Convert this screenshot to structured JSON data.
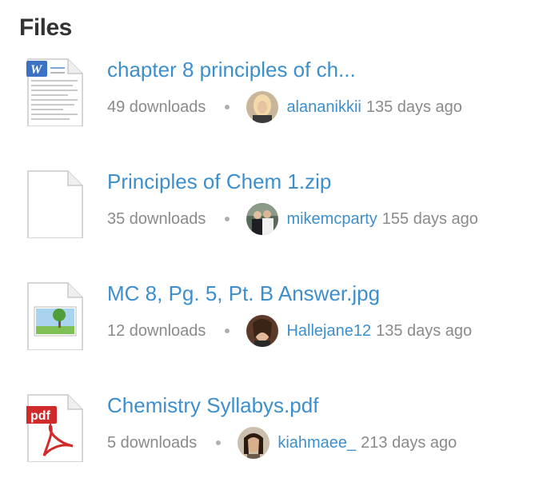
{
  "heading": "Files",
  "files": [
    {
      "icon": "word-document-icon",
      "title": "chapter 8 principles of ch...",
      "downloads": "49 downloads",
      "user": "alananikkii",
      "age": "135 days ago"
    },
    {
      "icon": "blank-file-icon",
      "title": "Principles of Chem 1.zip",
      "downloads": "35 downloads",
      "user": "mikemcparty",
      "age": "155 days ago"
    },
    {
      "icon": "image-file-icon",
      "title": "MC 8, Pg. 5, Pt. B Answer.jpg",
      "downloads": "12 downloads",
      "user": "Hallejane12",
      "age": "135 days ago"
    },
    {
      "icon": "pdf-file-icon",
      "title": "Chemistry Syllabys.pdf",
      "downloads": "5 downloads",
      "user": "kiahmaee_",
      "age": "213 days ago",
      "icon_label": "pdf"
    }
  ],
  "colors": {
    "link": "#3d8fcc",
    "muted": "#8a8a8a",
    "heading": "#333333",
    "word_blue": "#3b72c4",
    "pdf_red": "#d12a2a"
  }
}
